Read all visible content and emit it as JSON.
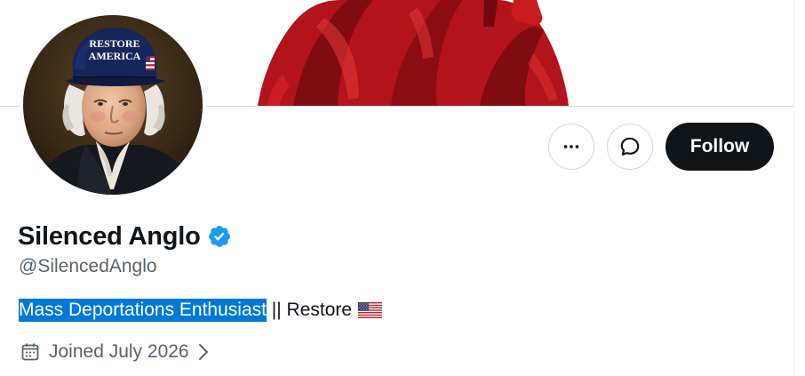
{
  "banner": {
    "icon": "banner-statue-image",
    "colors": {
      "primary": "#b3131a",
      "shadow": "#6e0a0e",
      "highlight": "#e53a3a"
    }
  },
  "avatar": {
    "icon": "avatar-portrait-image",
    "hat_text_line1": "RESTORE",
    "hat_text_line2": "AMERICA"
  },
  "actions": {
    "more_icon": "more-horizontal-icon",
    "message_icon": "message-icon",
    "follow_label": "Follow"
  },
  "profile": {
    "display_name": "Silenced Anglo",
    "verified_icon": "verified-badge-icon",
    "verified_color": "#1d9bf0",
    "handle": "@SilencedAnglo",
    "bio_highlighted": "Mass Deportations Enthusiast",
    "bio_rest": " || Restore",
    "bio_flag_icon": "us-flag-icon",
    "joined": "Joined July 2026",
    "calendar_icon": "calendar-icon",
    "chevron_icon": "chevron-right-icon"
  },
  "colors": {
    "text_primary": "#0f1419",
    "text_secondary": "#536471",
    "border": "#cfd9de",
    "selection": "#0078d7"
  }
}
